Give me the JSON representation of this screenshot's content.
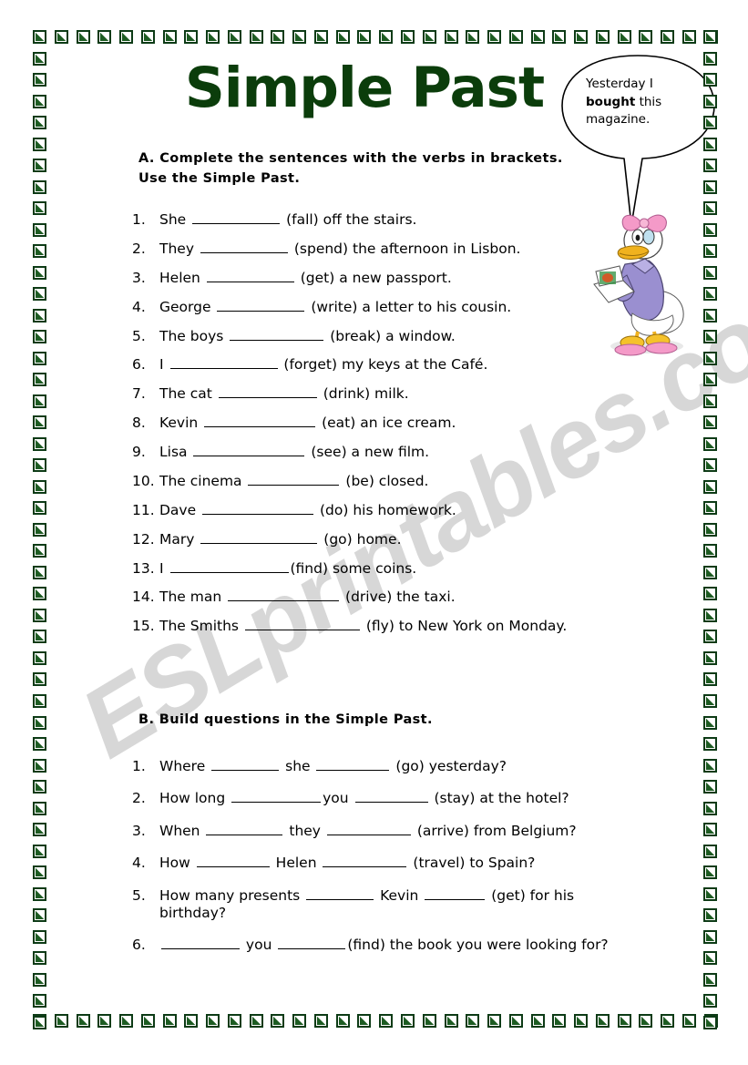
{
  "worksheet": {
    "title": "Simple Past",
    "watermark": "ESLprintables.com",
    "title_color": "#0b3d0b",
    "border_color": "#1d5c22"
  },
  "speech_bubble": {
    "line1": "Yesterday I",
    "bold_word": "bought",
    "line2_rest": " this",
    "line3": "magazine."
  },
  "illustration": {
    "name": "daisy-duck-reading-magazine"
  },
  "section_a": {
    "heading": "A.  Complete the sentences with the verbs in brackets. Use the Simple Past.",
    "items": [
      {
        "num": "1.",
        "before": "She ",
        "blank": 96,
        "after": " (fall) off the stairs."
      },
      {
        "num": "2.",
        "before": "They ",
        "blank": 96,
        "after": " (spend) the afternoon in Lisbon."
      },
      {
        "num": "3.",
        "before": "Helen ",
        "blank": 96,
        "after": " (get) a new passport."
      },
      {
        "num": "4.",
        "before": "George ",
        "blank": 96,
        "after": " (write) a letter to his cousin."
      },
      {
        "num": "5.",
        "before": "The boys ",
        "blank": 103,
        "after": " (break) a window."
      },
      {
        "num": "6.",
        "before": "I ",
        "blank": 118,
        "after": " (forget) my keys at the Café."
      },
      {
        "num": "7.",
        "before": "The cat ",
        "blank": 108,
        "after": " (drink) milk."
      },
      {
        "num": "8.",
        "before": "Kevin ",
        "blank": 122,
        "after": " (eat) an ice cream."
      },
      {
        "num": "9.",
        "before": "Lisa ",
        "blank": 122,
        "after": " (see) a new film."
      },
      {
        "num": "10.",
        "before": "The cinema ",
        "blank": 100,
        "after": " (be) closed."
      },
      {
        "num": "11.",
        "before": "Dave ",
        "blank": 122,
        "after": " (do) his homework."
      },
      {
        "num": "12.",
        "before": "Mary ",
        "blank": 128,
        "after": " (go) home."
      },
      {
        "num": "13.",
        "before": "I  ",
        "blank": 130,
        "after": "(find) some coins."
      },
      {
        "num": "14.",
        "before": "The man ",
        "blank": 122,
        "after": " (drive) the taxi."
      },
      {
        "num": "15.",
        "before": "The Smiths ",
        "blank": 126,
        "after": " (fly) to New York on Monday."
      }
    ]
  },
  "section_b": {
    "heading": "B.  Build questions in the Simple Past.",
    "items": [
      {
        "num": "1.",
        "parts": [
          {
            "text": "Where "
          },
          {
            "blank": 74
          },
          {
            "text": " she "
          },
          {
            "blank": 80
          },
          {
            "text": " (go) yesterday?"
          }
        ]
      },
      {
        "num": "2.",
        "parts": [
          {
            "text": "How long "
          },
          {
            "blank": 98
          },
          {
            "text": "you "
          },
          {
            "blank": 80
          },
          {
            "text": " (stay) at the hotel?"
          }
        ]
      },
      {
        "num": "3.",
        "parts": [
          {
            "text": "When "
          },
          {
            "blank": 84
          },
          {
            "text": " they "
          },
          {
            "blank": 92
          },
          {
            "text": " (arrive) from Belgium?"
          }
        ]
      },
      {
        "num": "4.",
        "parts": [
          {
            "text": "How "
          },
          {
            "blank": 80
          },
          {
            "text": " Helen "
          },
          {
            "blank": 92
          },
          {
            "text": " (travel) to Spain?"
          }
        ]
      },
      {
        "num": "5.",
        "parts": [
          {
            "text": "How many presents "
          },
          {
            "blank": 74
          },
          {
            "text": " Kevin "
          },
          {
            "blank": 66
          },
          {
            "text": " (get) for his"
          },
          {
            "break": true
          },
          {
            "text": "birthday?"
          }
        ]
      },
      {
        "num": "6.",
        "parts": [
          {
            "blank": 86
          },
          {
            "text": " you "
          },
          {
            "blank": 74
          },
          {
            "text": "(find) the book you were looking for?"
          }
        ]
      }
    ]
  }
}
